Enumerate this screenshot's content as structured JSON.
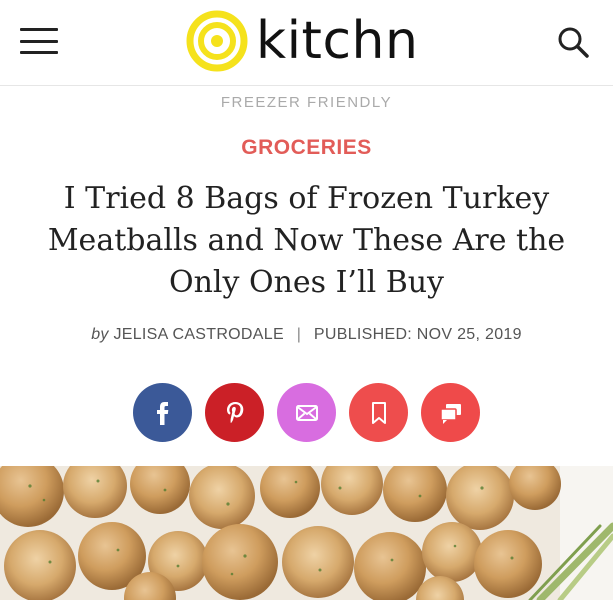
{
  "header": {
    "logo_text": "kitchn",
    "logo_color": "#f5e21c",
    "menu_icon": "hamburger-menu-icon",
    "search_icon": "search-icon"
  },
  "article": {
    "kicker": "FREEZER FRIENDLY",
    "category": "GROCERIES",
    "category_color": "#e25c58",
    "title_lines": [
      "I Tried 8 Bags of Frozen Turkey",
      "Meatballs and Now These Are the",
      "Only Ones I’ll Buy"
    ],
    "byline": {
      "by": "by",
      "author": "JELISA CASTRODALE",
      "separator": "|",
      "published": "PUBLISHED: NOV 25, 2019"
    }
  },
  "share": [
    {
      "name": "facebook",
      "icon": "facebook-icon",
      "color": "#3b5998"
    },
    {
      "name": "pinterest",
      "icon": "pinterest-icon",
      "color": "#cb2027"
    },
    {
      "name": "email",
      "icon": "email-icon",
      "color": "#d86de0"
    },
    {
      "name": "bookmark",
      "icon": "bookmark-icon",
      "color": "#ee4d4d"
    },
    {
      "name": "comments",
      "icon": "comments-icon",
      "color": "#ef4a4a"
    }
  ],
  "hero_image": {
    "subject": "baked-turkey-meatballs"
  }
}
